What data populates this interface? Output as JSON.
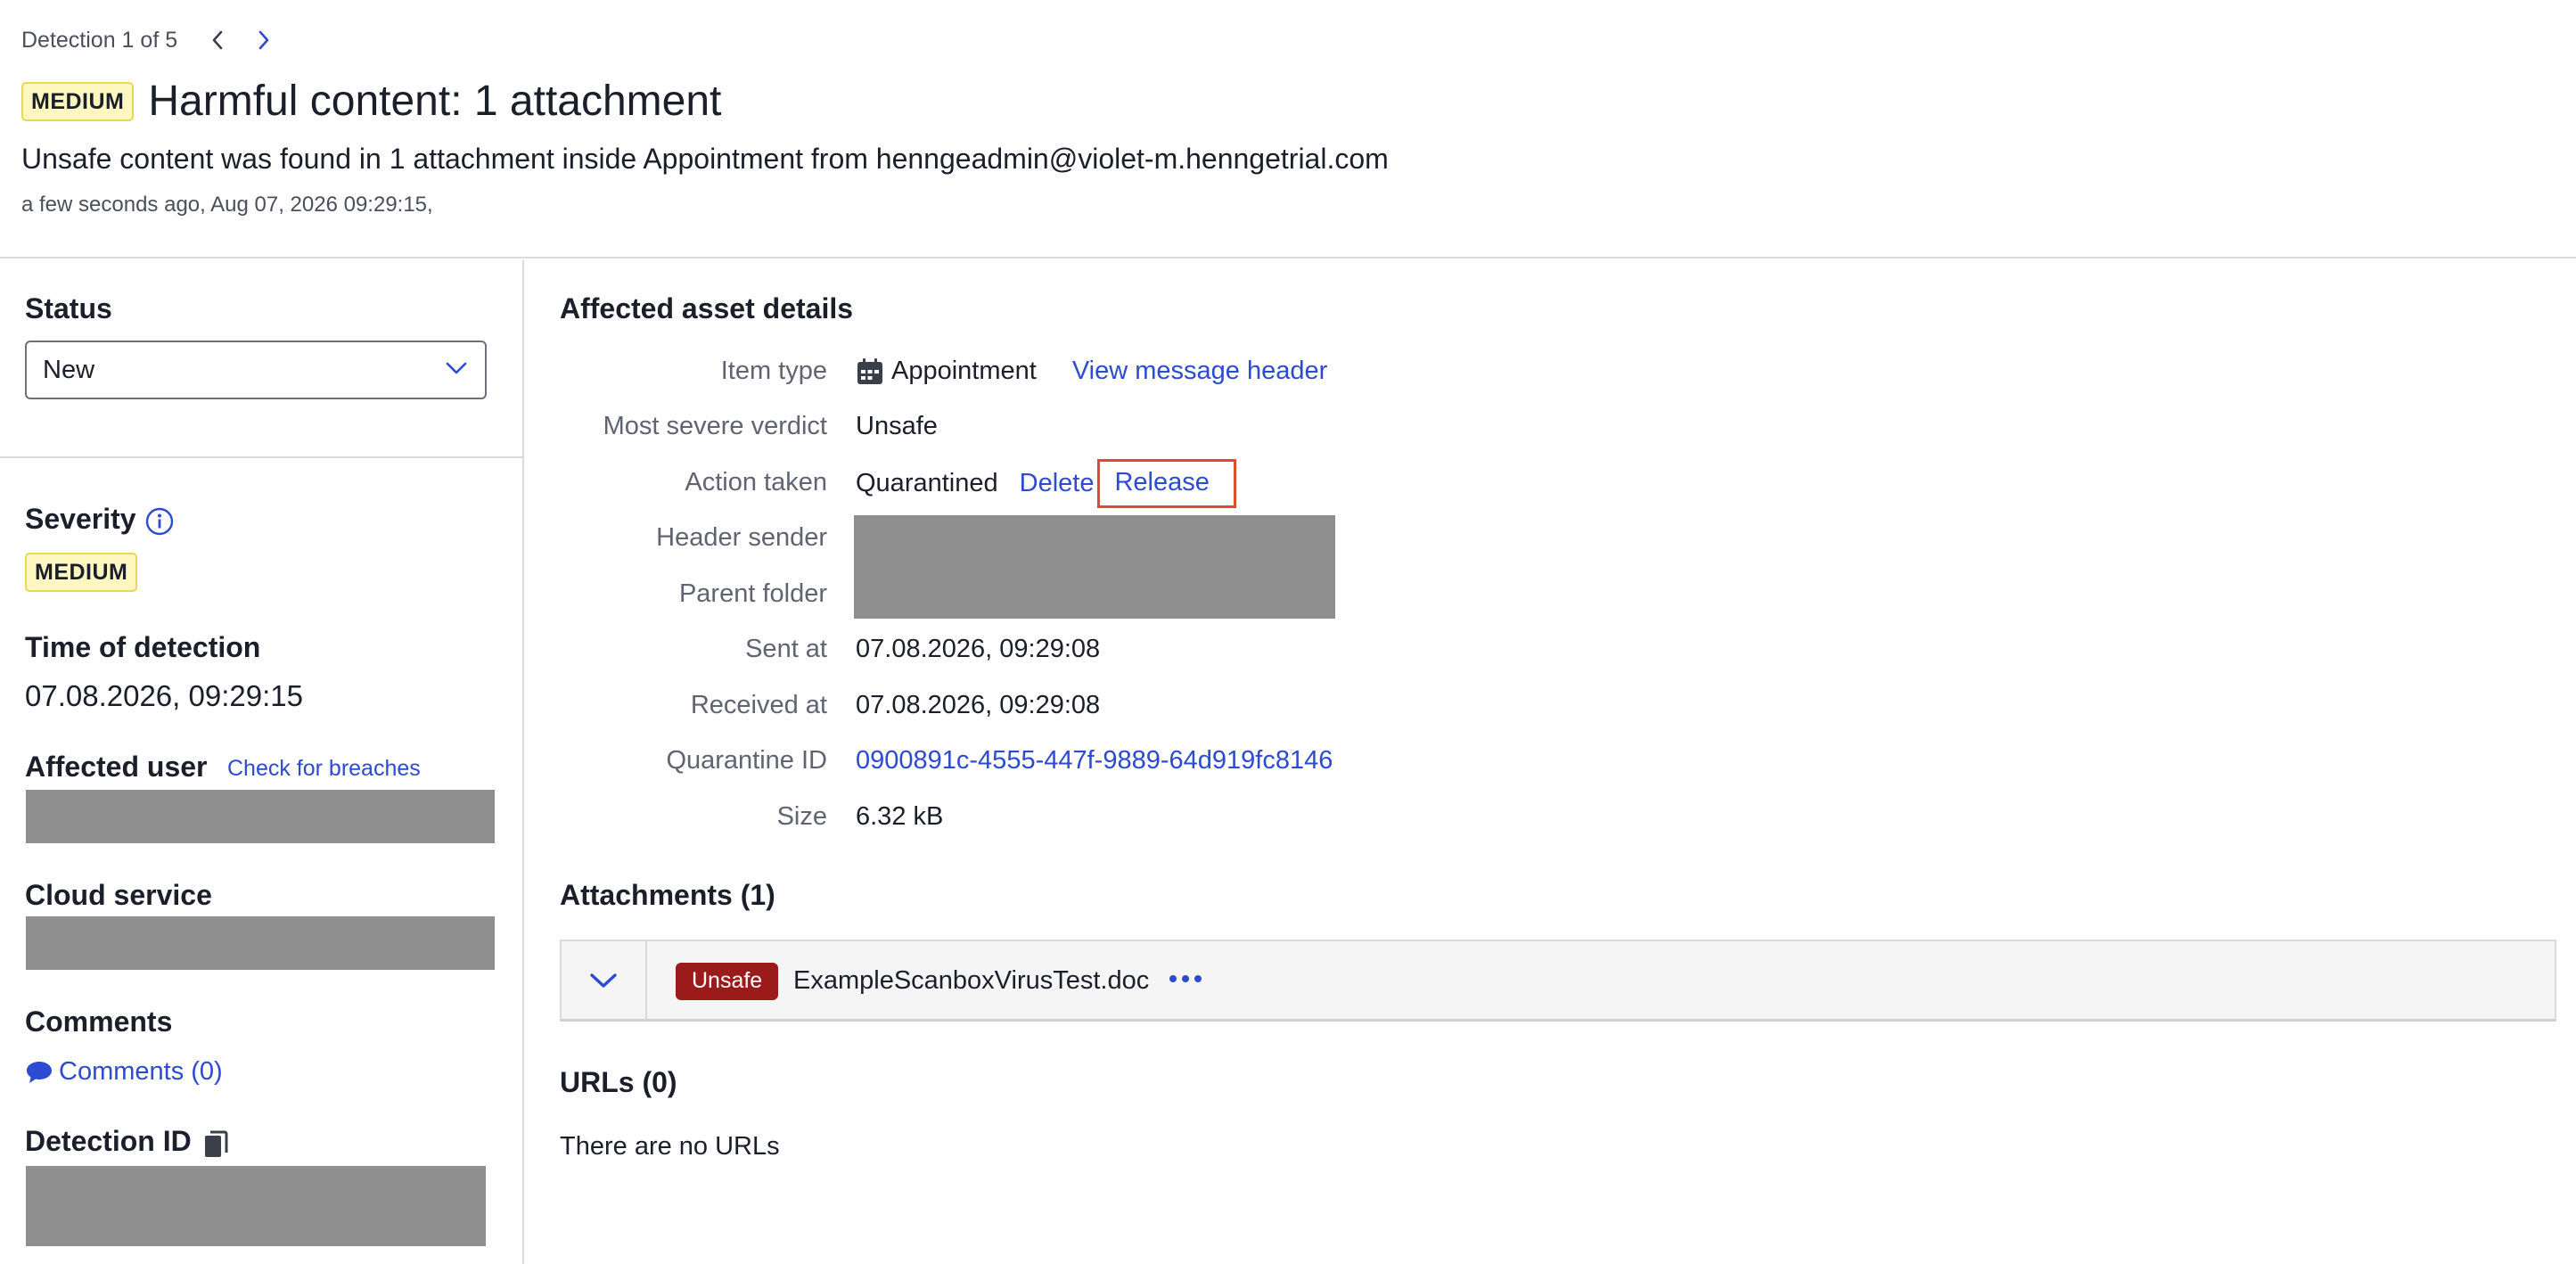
{
  "header": {
    "counter": "Detection 1 of 5",
    "severity_badge": "MEDIUM",
    "title": "Harmful content: 1 attachment",
    "subtitle": "Unsafe content was found in 1 attachment inside Appointment from henngeadmin@violet-m.henngetrial.com",
    "timestamp": "a few seconds ago, Aug 07, 2026 09:29:15,"
  },
  "sidebar": {
    "status_title": "Status",
    "status_value": "New",
    "severity_title": "Severity",
    "severity_value": "MEDIUM",
    "time_title": "Time of detection",
    "time_value": "07.08.2026, 09:29:15",
    "affected_user_title": "Affected user",
    "check_breaches": "Check for breaches",
    "cloud_service_title": "Cloud service",
    "comments_title": "Comments",
    "comments_link": "Comments (0)",
    "detection_id_title": "Detection ID"
  },
  "details": {
    "title": "Affected asset details",
    "item_type_label": "Item type",
    "item_type_value": "Appointment",
    "view_header_link": "View message header",
    "verdict_label": "Most severe verdict",
    "verdict_value": "Unsafe",
    "action_label": "Action taken",
    "action_value": "Quarantined",
    "delete_link": "Delete",
    "release_link": "Release",
    "header_sender_label": "Header sender",
    "parent_folder_label": "Parent folder",
    "sent_label": "Sent at",
    "sent_value": "07.08.2026, 09:29:08",
    "received_label": "Received at",
    "received_value": "07.08.2026, 09:29:08",
    "quarantine_label": "Quarantine ID",
    "quarantine_value": "0900891c-4555-447f-9889-64d919fc8146",
    "size_label": "Size",
    "size_value": "6.32 kB"
  },
  "attachments": {
    "title": "Attachments (1)",
    "items": [
      {
        "verdict": "Unsafe",
        "name": "ExampleScanboxVirusTest.doc"
      }
    ]
  },
  "urls": {
    "title": "URLs (0)",
    "empty_text": "There are no URLs"
  },
  "colors": {
    "accent": "#2c4bd0",
    "unsafe": "#9b1b1b",
    "highlight_border": "#e04a2f",
    "medium_badge_bg": "#fff7bf"
  },
  "icons": [
    "chevron-left-icon",
    "chevron-right-icon",
    "chevron-down-icon",
    "info-icon",
    "calendar-icon",
    "comment-icon",
    "copy-icon",
    "more-icon"
  ]
}
